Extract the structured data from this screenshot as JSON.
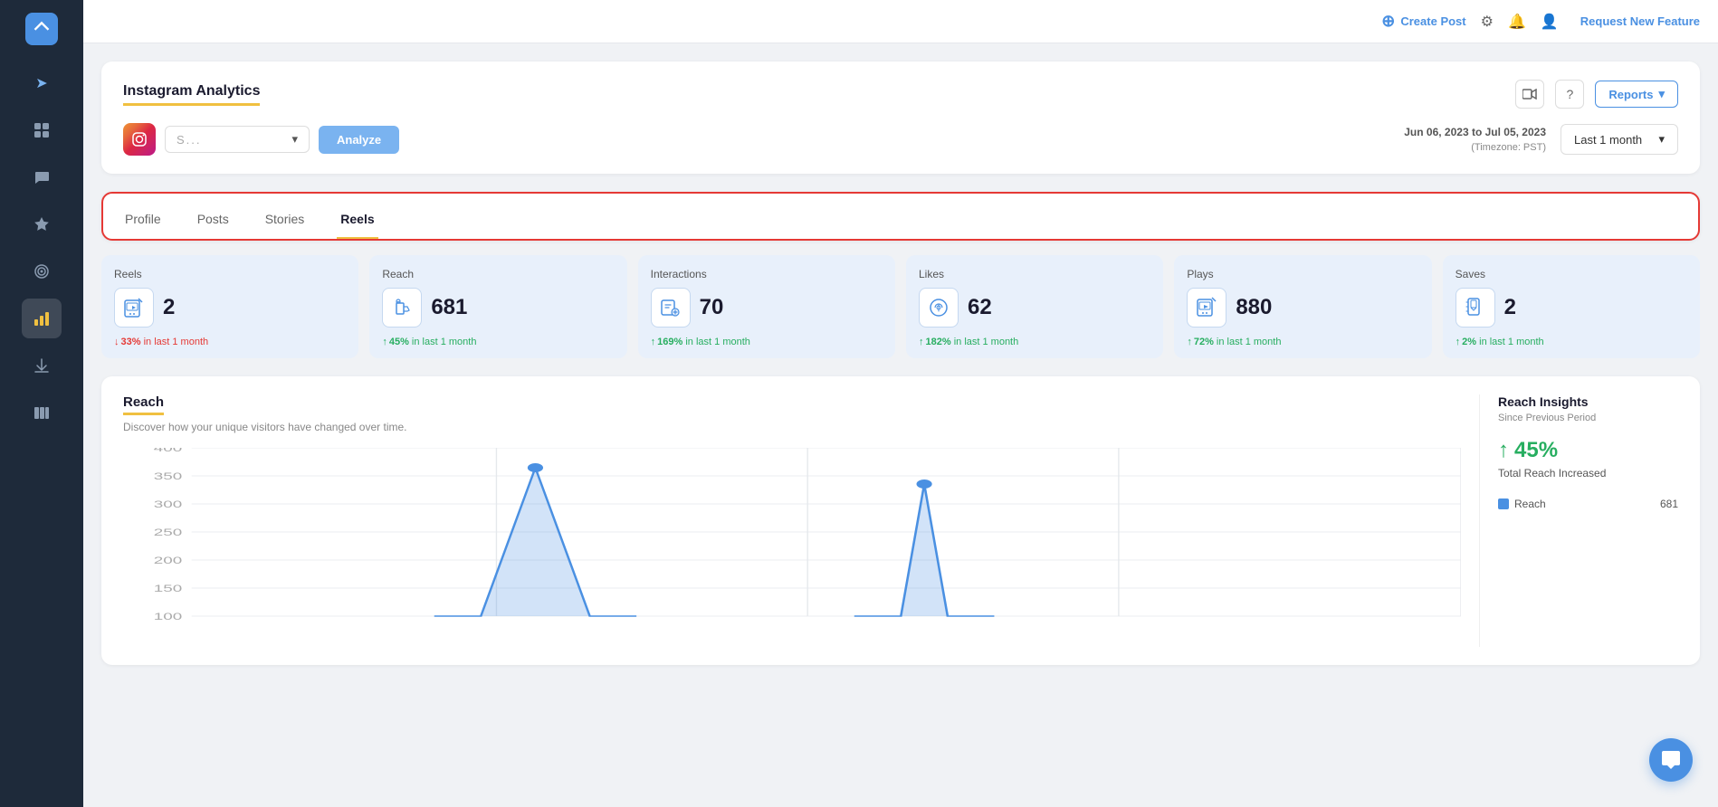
{
  "topbar": {
    "create_post": "Create Post",
    "request_feature": "Request New Feature"
  },
  "analytics": {
    "title": "Instagram Analytics",
    "account_placeholder": "S...",
    "analyze_btn": "Analyze",
    "date_range": "Jun 06, 2023 to Jul 05, 2023",
    "timezone": "(Timezone: PST)",
    "period": "Last 1 month",
    "reports_btn": "Reports"
  },
  "tabs": [
    {
      "id": "profile",
      "label": "Profile"
    },
    {
      "id": "posts",
      "label": "Posts"
    },
    {
      "id": "stories",
      "label": "Stories"
    },
    {
      "id": "reels",
      "label": "Reels",
      "active": true
    }
  ],
  "metrics": [
    {
      "id": "reels",
      "label": "Reels",
      "value": "2",
      "change": "33%",
      "direction": "down",
      "change_text": "in last 1 month",
      "icon": "video"
    },
    {
      "id": "reach",
      "label": "Reach",
      "value": "681",
      "change": "45%",
      "direction": "up",
      "change_text": "in last 1 month",
      "icon": "megaphone"
    },
    {
      "id": "interactions",
      "label": "Interactions",
      "value": "70",
      "change": "169%",
      "direction": "up",
      "change_text": "in last 1 month",
      "icon": "interactions"
    },
    {
      "id": "likes",
      "label": "Likes",
      "value": "62",
      "change": "182%",
      "direction": "up",
      "change_text": "in last 1 month",
      "icon": "clock"
    },
    {
      "id": "plays",
      "label": "Plays",
      "value": "880",
      "change": "72%",
      "direction": "up",
      "change_text": "in last 1 month",
      "icon": "play"
    },
    {
      "id": "saves",
      "label": "Saves",
      "value": "2",
      "change": "2%",
      "direction": "up",
      "change_text": "in last 1 month",
      "icon": "bookmark"
    }
  ],
  "chart": {
    "title": "Reach",
    "subtitle": "Discover how your unique visitors have changed over time.",
    "y_labels": [
      "400",
      "350",
      "300",
      "250",
      "200",
      "150",
      "100"
    ],
    "insights": {
      "title": "Reach Insights",
      "subtitle": "Since Previous Period",
      "percentage": "↑ 45%",
      "description": "Total Reach Increased",
      "legend_label": "Reach",
      "legend_value": "681"
    }
  },
  "sidebar": {
    "icons": [
      {
        "id": "navigate",
        "symbol": "➤"
      },
      {
        "id": "dashboard",
        "symbol": "⊞"
      },
      {
        "id": "messages",
        "symbol": "💬"
      },
      {
        "id": "star",
        "symbol": "✦"
      },
      {
        "id": "target",
        "symbol": "◎"
      },
      {
        "id": "chart",
        "symbol": "📊",
        "active": true
      },
      {
        "id": "download",
        "symbol": "⬇"
      },
      {
        "id": "books",
        "symbol": "📚"
      }
    ]
  }
}
